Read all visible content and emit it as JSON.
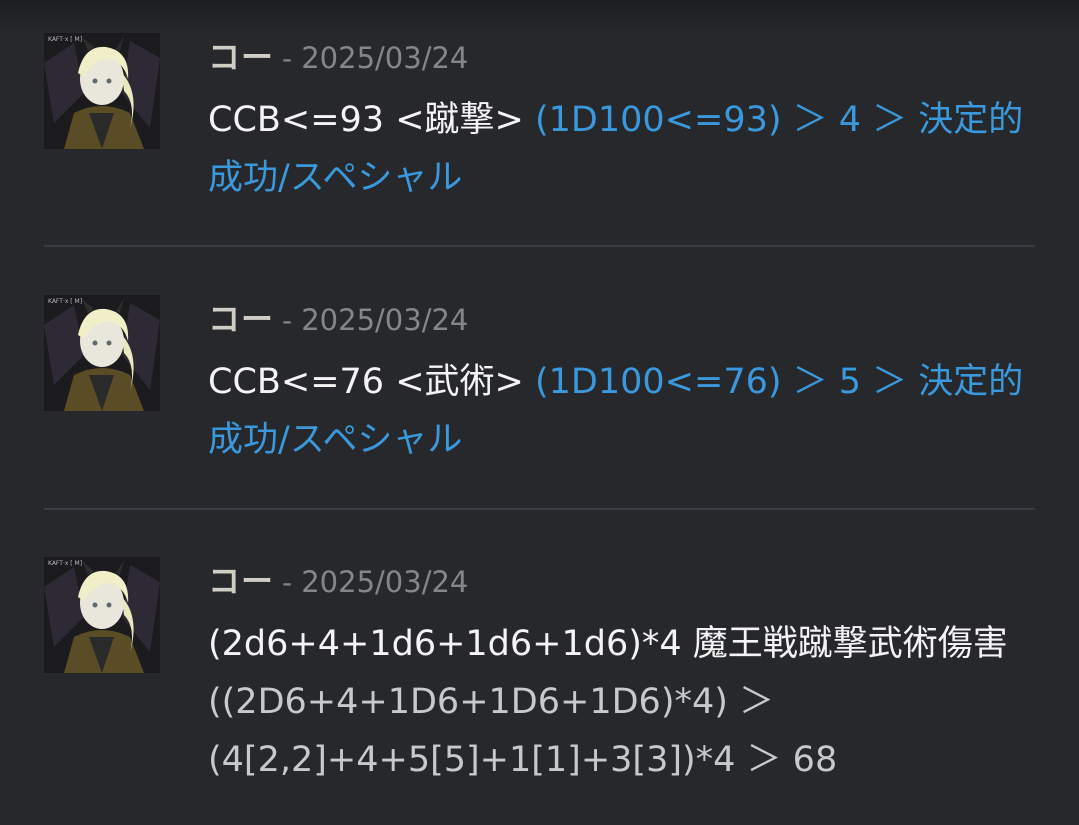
{
  "messages": [
    {
      "author": "コー",
      "separator": "-",
      "date": "2025/03/24",
      "command": "CCB<=93 <蹴撃>",
      "result": "(1D100<=93) ＞ 4 ＞ 決定的成功/スペシャル",
      "result_color": "#3a98dc"
    },
    {
      "author": "コー",
      "separator": "-",
      "date": "2025/03/24",
      "command": "CCB<=76 <武術>",
      "result": "(1D100<=76) ＞ 5 ＞ 決定的成功/スペシャル",
      "result_color": "#3a98dc"
    },
    {
      "author": "コー",
      "separator": "-",
      "date": "2025/03/24",
      "command": "(2d6+4+1d6+1d6+1d6)*4 魔王戦蹴撃武術傷害",
      "result": "((2D6+4+1D6+1D6+1D6)*4) ＞ (4[2,2]+4+5[5]+1[1]+3[3])*4 ＞ 68",
      "result_color": "#c8c9cc"
    }
  ],
  "avatar_icon": "character-portrait-icon",
  "colors": {
    "background": "#27282c",
    "author": "#d0cdc4",
    "date": "#85868a",
    "success_result": "#3a98dc",
    "plain_result": "#c8c9cc"
  }
}
